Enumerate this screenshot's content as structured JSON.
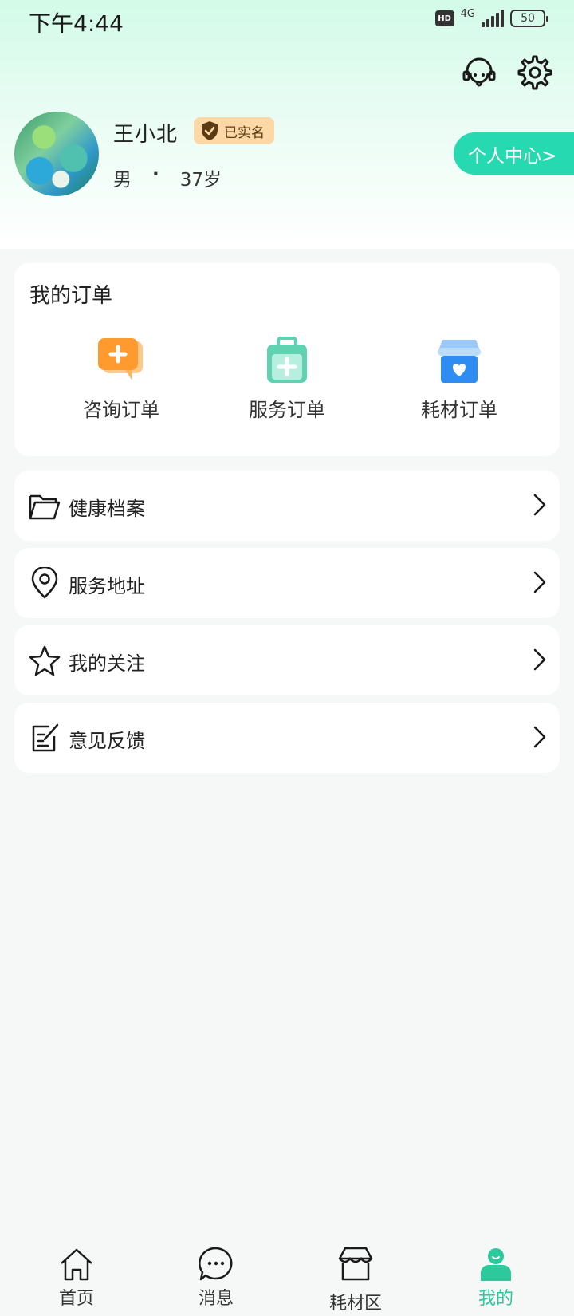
{
  "status_bar": {
    "time": "下午4:44",
    "hd": "HD",
    "network": "4G",
    "battery": "50"
  },
  "header": {
    "service_icon": "headset-icon",
    "settings_icon": "gear-icon"
  },
  "profile": {
    "name": "王小北",
    "verified_label": "已实名",
    "gender": "男",
    "separator": "·",
    "age": "37岁",
    "personal_center_label": "个人中心>"
  },
  "orders": {
    "title": "我的订单",
    "items": [
      {
        "label": "咨询订单",
        "icon": "consult-chat-icon",
        "color": "#ff9a2e"
      },
      {
        "label": "服务订单",
        "icon": "medical-kit-icon",
        "color": "#5fd2b2"
      },
      {
        "label": "耗材订单",
        "icon": "store-heart-icon",
        "color": "#2f8cf2"
      }
    ]
  },
  "menu": [
    {
      "label": "健康档案",
      "icon": "folder-icon"
    },
    {
      "label": "服务地址",
      "icon": "location-pin-icon"
    },
    {
      "label": "我的关注",
      "icon": "star-icon"
    },
    {
      "label": "意见反馈",
      "icon": "feedback-edit-icon"
    }
  ],
  "tabs": [
    {
      "label": "首页",
      "icon": "home-icon",
      "active": false
    },
    {
      "label": "消息",
      "icon": "message-bubble-icon",
      "active": false
    },
    {
      "label": "耗材区",
      "icon": "store-icon",
      "active": false
    },
    {
      "label": "我的",
      "icon": "user-icon",
      "active": true
    }
  ],
  "colors": {
    "accent": "#27d9b0",
    "active_tab": "#2bc99b",
    "verified_bg": "#fbd8a6",
    "page_bg": "#f6f8f7"
  }
}
